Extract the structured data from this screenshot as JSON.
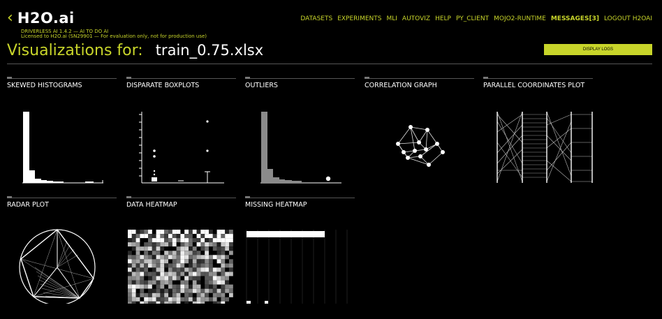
{
  "app": {
    "logo_text": "H2O.ai",
    "version_line": "DRIVERLESS AI 1.4.2 — AI TO DO AI",
    "license_line": "Licensed to H2O.ai (SN29901 — For evaluation only, not for production use)"
  },
  "nav": {
    "items": [
      "DATASETS",
      "EXPERIMENTS",
      "MLI",
      "AUTOVIZ",
      "HELP",
      "PY_CLIENT",
      "MOJO2-RUNTIME",
      "MESSAGES[3]",
      "LOGOUT H2OAI"
    ]
  },
  "page": {
    "title_label": "Visualizations for:",
    "file_name": "train_0.75.xlsx",
    "display_logs_label": "DISPLAY LOGS"
  },
  "cards": [
    {
      "title": "SKEWED HISTOGRAMS"
    },
    {
      "title": "DISPARATE BOXPLOTS"
    },
    {
      "title": "OUTLIERS"
    },
    {
      "title": "CORRELATION GRAPH"
    },
    {
      "title": "PARALLEL COORDINATES PLOT"
    },
    {
      "title": "RADAR PLOT"
    },
    {
      "title": "DATA HEATMAP"
    },
    {
      "title": "MISSING HEATMAP"
    }
  ],
  "colors": {
    "accent": "#c8d52a",
    "background": "#000000"
  }
}
